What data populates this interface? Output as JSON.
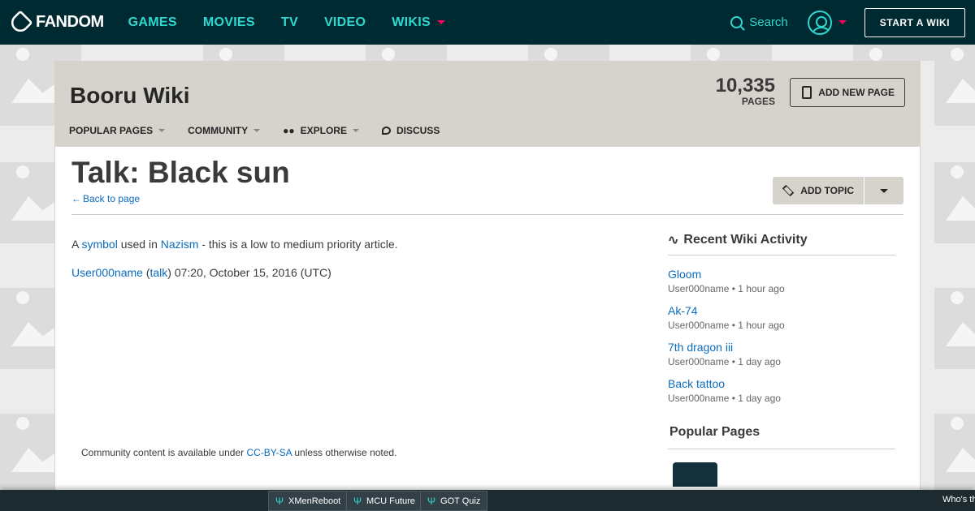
{
  "topnav": {
    "logo_text": "FANDOM",
    "links": [
      "GAMES",
      "MOVIES",
      "TV",
      "VIDEO",
      "WIKIS"
    ],
    "search_label": "Search",
    "start_wiki_label": "START A WIKI"
  },
  "wiki": {
    "name": "Booru Wiki",
    "pages_count": "10,335",
    "pages_label": "PAGES",
    "add_page_label": "ADD NEW PAGE",
    "nav": [
      "POPULAR PAGES",
      "COMMUNITY",
      "EXPLORE",
      "DISCUSS"
    ]
  },
  "page": {
    "title": "Talk: Black sun",
    "back_label": "Back to page",
    "add_topic_label": "ADD TOPIC",
    "para1": {
      "a": "A ",
      "link1": "symbol",
      "b": " used in ",
      "link2": "Nazism",
      "c": " - this is a low to medium priority article."
    },
    "para2": {
      "user": "User000name",
      "open": " (",
      "talk": "talk",
      "rest": ") 07:20, October 15, 2016 (UTC)"
    },
    "license": {
      "a": "Community content is available under ",
      "link": "CC-BY-SA",
      "b": " unless otherwise noted."
    }
  },
  "rail": {
    "activity_title": "Recent Wiki Activity",
    "items": [
      {
        "title": "Gloom",
        "meta": "User000name • 1 hour ago"
      },
      {
        "title": "Ak-74",
        "meta": "User000name • 1 hour ago"
      },
      {
        "title": "7th dragon iii",
        "meta": "User000name • 1 day ago"
      },
      {
        "title": "Back tattoo",
        "meta": "User000name • 1 day ago"
      }
    ],
    "popular_title": "Popular Pages"
  },
  "bottombar": {
    "tabs": [
      "XMenReboot",
      "MCU Future",
      "GOT Quiz"
    ],
    "right_text": "Who's th"
  },
  "colors": {
    "topnav_bg": "#002a32",
    "accent": "#2dd9d0",
    "link": "#0b6bbd",
    "header_bg": "#d6d2cc"
  }
}
